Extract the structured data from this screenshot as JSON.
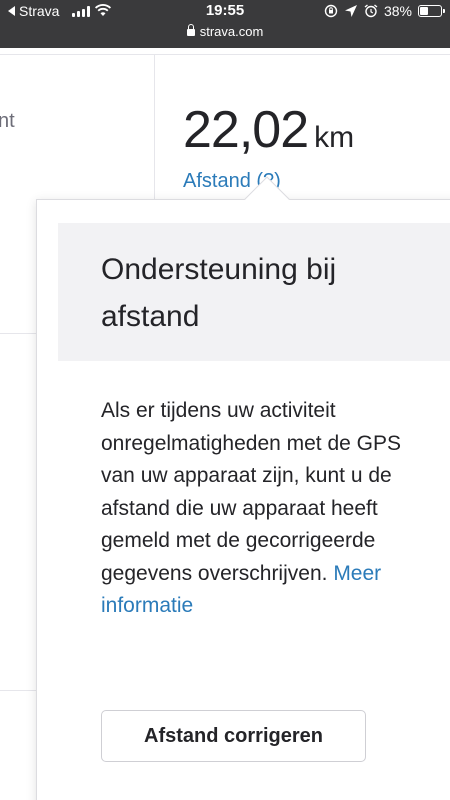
{
  "status_bar": {
    "back_app": "Strava",
    "time": "19:55",
    "url": "strava.com",
    "battery": "38%",
    "battery_level": 0.38
  },
  "background": {
    "partial_label": "nt",
    "stat_value": "22,02",
    "stat_unit": "km",
    "stat_link": "Afstand (?)"
  },
  "popover": {
    "title": "Ondersteuning bij afstand",
    "body": "Als er tijdens uw activiteit onregelmatigheden met de GPS van uw apparaat zijn, kunt u de afstand die uw apparaat heeft gemeld met de gecorrigeerde gegevens overschrijven.",
    "more_link": "Meer informatie",
    "button_label": "Afstand corrigeren"
  },
  "colors": {
    "link": "#2b7bb9",
    "status_bar": "#3a3a3c",
    "header_bg": "#f2f2f4"
  }
}
